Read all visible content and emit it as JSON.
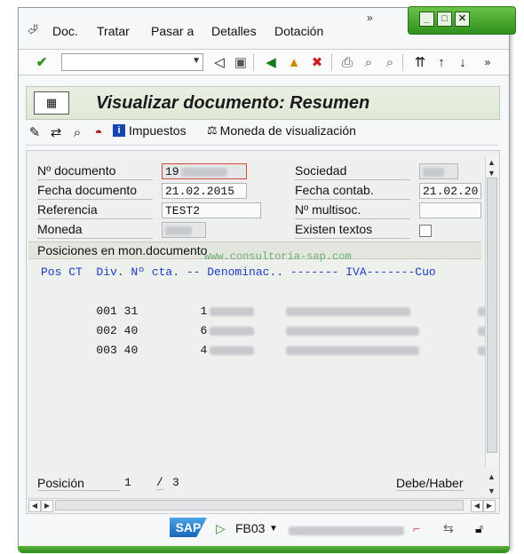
{
  "menu": {
    "items": [
      "Doc.",
      "Tratar",
      "Pasar a",
      "Detalles",
      "Dotación"
    ],
    "more": "»"
  },
  "window_controls": [
    "minimize",
    "maximize",
    "close"
  ],
  "toolbar": {
    "command_field_value": "",
    "more": "»"
  },
  "page": {
    "title": "Visualizar documento: Resumen"
  },
  "app_toolbar": {
    "taxes_label": "Impuestos",
    "currency_label": "Moneda de visualización"
  },
  "header_fields": {
    "doc_number_label": "Nº documento",
    "doc_number_value": "19",
    "doc_date_label": "Fecha documento",
    "doc_date_value": "21.02.2015",
    "reference_label": "Referencia",
    "reference_value": "TEST2",
    "currency_label": "Moneda",
    "company_label": "Sociedad",
    "posting_date_label": "Fecha contab.",
    "posting_date_value": "21.02.20",
    "multico_label": "Nº multisoc.",
    "texts_exist_label": "Existen textos"
  },
  "items_section": {
    "title": "Posiciones en mon.documento",
    "watermark": "www.consultoria-sap.com",
    "header": "Pos CT  Div. Nº cta. -- Denominac.. ------- IVA-------Cuo",
    "rows": [
      {
        "pos": "001",
        "ct": "31",
        "account": "1"
      },
      {
        "pos": "002",
        "ct": "40",
        "account": "6"
      },
      {
        "pos": "003",
        "ct": "40",
        "account": "4"
      }
    ]
  },
  "footer": {
    "position_label": "Posición",
    "position_current": "1",
    "position_separator": "/",
    "position_total": "3",
    "debit_credit_label": "Debe/Haber"
  },
  "statusbar": {
    "logo": "SAP",
    "transaction": "FB03"
  },
  "colors": {
    "accent_green": "#2f8f1c",
    "list_header_blue": "#1a3dbf",
    "title_band": "#e3ead9"
  }
}
